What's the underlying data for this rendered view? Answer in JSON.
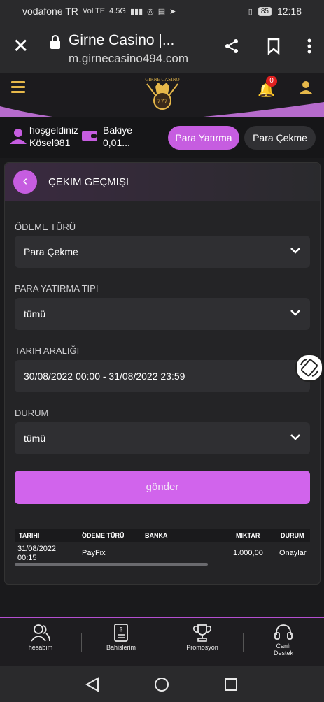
{
  "status_bar": {
    "carrier": "vodafone TR",
    "network_badges": [
      "VoLTE",
      "4.5G"
    ],
    "battery": "85",
    "time": "12:18"
  },
  "browser": {
    "title": "Girne Casino |...",
    "url": "m.girnecasino494.com"
  },
  "header": {
    "logo_text": "GIRNE CASINO",
    "notification_count": "0",
    "accent": "#c65de0",
    "gold": "#e6b84a"
  },
  "user": {
    "greeting": "hoşgeldiniz",
    "username": "Kösel981",
    "balance_label": "Bakiye",
    "balance_value": "0,01...",
    "deposit_button": "Para Yatırma",
    "withdraw_button": "Para Çekme"
  },
  "panel": {
    "title": "ÇEKIM GEÇMIŞI",
    "fields": [
      {
        "label": "ÖDEME TÜRÜ",
        "value": "Para Çekme"
      },
      {
        "label": "PARA YATIRMA TIPI",
        "value": "tümü"
      },
      {
        "label": "TARIH ARALIĞI",
        "value": "30/08/2022 00:00 - 31/08/2022 23:59"
      },
      {
        "label": "DURUM",
        "value": "tümü"
      }
    ],
    "submit": "gönder"
  },
  "table": {
    "columns": [
      "TARIHI",
      "ÖDEME TÜRÜ",
      "BANKA",
      "MIKTAR",
      "DURUM"
    ],
    "rows": [
      {
        "date": "31/08/2022",
        "time": "00:15",
        "type": "PayFix",
        "bank": "",
        "amount": "1.000,00",
        "status": "Onaylar"
      }
    ]
  },
  "bottom_nav": [
    {
      "label": "hesabım",
      "icon": "users-icon"
    },
    {
      "label": "Bahislerim",
      "icon": "receipt-icon"
    },
    {
      "label": "Promosyon",
      "icon": "trophy-icon"
    },
    {
      "label": "Canlı\nDestek",
      "icon": "headset-icon"
    }
  ]
}
